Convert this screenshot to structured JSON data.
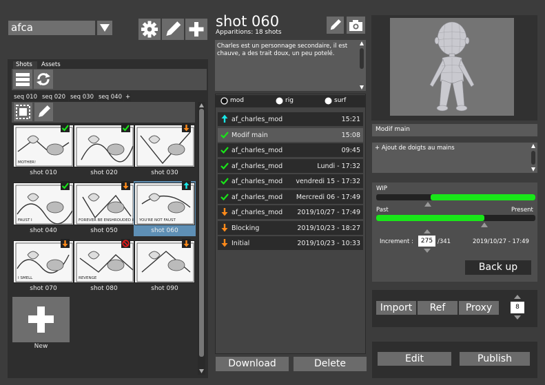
{
  "project": {
    "name": "afca"
  },
  "left_panel": {
    "tabs": [
      "Shots",
      "Assets"
    ],
    "sequences": [
      "seq 010",
      "seq 020",
      "seq 030",
      "seq 040",
      "+"
    ],
    "shots": [
      {
        "name": "shot 010",
        "status": "done",
        "caption": "MOTHER!"
      },
      {
        "name": "shot 020",
        "status": "done",
        "caption": ""
      },
      {
        "name": "shot 030",
        "status": "todo",
        "caption": ""
      },
      {
        "name": "shot 040",
        "status": "done",
        "caption": "FAUST  I"
      },
      {
        "name": "shot 050",
        "status": "todo",
        "caption": "FOREVER BE ENSHROUDED IN THE"
      },
      {
        "name": "shot 060",
        "status": "selected",
        "caption": "YOU'RE NOT FAUST"
      },
      {
        "name": "shot 070",
        "status": "todo",
        "caption": "I SMELL"
      },
      {
        "name": "shot 080",
        "status": "blocked",
        "caption": "REVENGE"
      },
      {
        "name": "shot 090",
        "status": "todo",
        "caption": ""
      }
    ],
    "new_label": "New"
  },
  "shot": {
    "title": "shot 060",
    "subtitle": "Apparitions: 18 shots",
    "description": "Charles est un personnage secondaire, il est chauve, a des trait doux, un peu potelé."
  },
  "departments": [
    "mod",
    "rig",
    "surf"
  ],
  "versions": [
    {
      "name": "af_charles_mod",
      "date": "15:21",
      "icon": "publish"
    },
    {
      "name": "Modif main",
      "date": "15:08",
      "icon": "check"
    },
    {
      "name": "af_charles_mod",
      "date": "09:45",
      "icon": "check"
    },
    {
      "name": "af_charles_mod",
      "date": "Lundi - 17:32",
      "icon": "check"
    },
    {
      "name": "af_charles_mod",
      "date": "vendredi 15 - 17:32",
      "icon": "check"
    },
    {
      "name": "af_charles_mod",
      "date": "Mercredi 06 - 17:49",
      "icon": "check"
    },
    {
      "name": "af_charles_mod",
      "date": "2019/10/27 - 17:49",
      "icon": "down"
    },
    {
      "name": "Blocking",
      "date": "2019/10/23 - 18:27",
      "icon": "down"
    },
    {
      "name": "Initial",
      "date": "2019/10/23 - 10:33",
      "icon": "down"
    }
  ],
  "actions": {
    "download": "Download",
    "delete": "Delete"
  },
  "detail": {
    "version_title": "Modif main",
    "note": "+ Ajout de doigts au mains",
    "wip_label": "WIP",
    "wip_progress": 0.66,
    "past_label": "Past",
    "present_label": "Present",
    "past_progress": 0.68,
    "increment_label": "Increment :",
    "increment_value": "275",
    "increment_total": "/341",
    "increment_date": "2019/10/27 - 17:49",
    "backup": "Back up",
    "import": "Import",
    "ref": "Ref",
    "proxy": "Proxy",
    "proxy_count": "8",
    "edit": "Edit",
    "publish": "Publish"
  },
  "colors": {
    "accent_green": "#19e619",
    "publish_cyan": "#19e6e6",
    "todo_orange": "#ff8a1a",
    "blocked_red": "#e01a1a",
    "selected": "#5e8fb5"
  }
}
